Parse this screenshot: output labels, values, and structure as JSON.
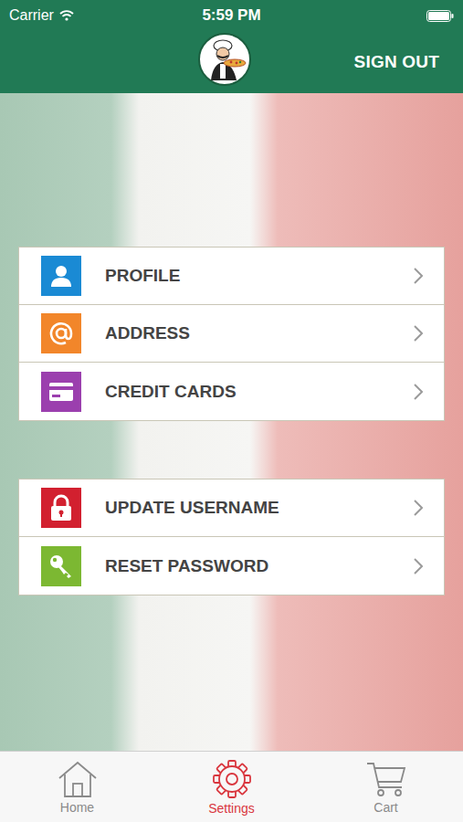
{
  "status_bar": {
    "carrier": "Carrier",
    "time": "5:59 PM"
  },
  "header": {
    "action": "SIGN OUT"
  },
  "menu_groups": [
    {
      "items": [
        {
          "label": "PROFILE",
          "color": "#1a8ad4"
        },
        {
          "label": "ADDRESS",
          "color": "#f2862a"
        },
        {
          "label": "CREDIT CARDS",
          "color": "#9b3fae"
        }
      ]
    },
    {
      "items": [
        {
          "label": "UPDATE USERNAME",
          "color": "#d2202f"
        },
        {
          "label": "RESET PASSWORD",
          "color": "#7cb832"
        }
      ]
    }
  ],
  "tab_bar": [
    {
      "label": "Home",
      "selected": false
    },
    {
      "label": "Settings",
      "selected": true
    },
    {
      "label": "Cart",
      "selected": false
    }
  ]
}
